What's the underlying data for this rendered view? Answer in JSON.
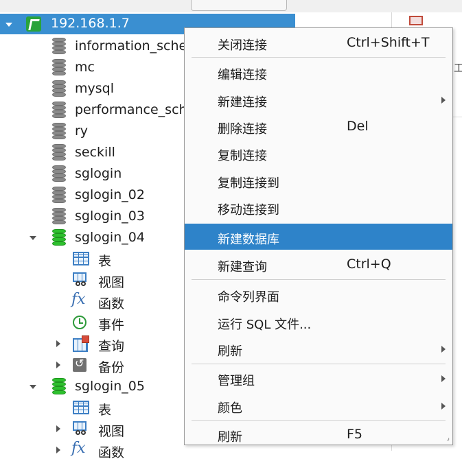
{
  "tree": {
    "connection": "192.168.1.7",
    "databases_a": [
      "information_schema",
      "mc",
      "mysql",
      "performance_schema",
      "ry",
      "seckill",
      "sglogin",
      "sglogin_02",
      "sglogin_03"
    ],
    "db_04": "sglogin_04",
    "db_04_children": [
      "表",
      "视图",
      "函数",
      "事件",
      "查询",
      "备份"
    ],
    "db_05": "sglogin_05",
    "db_05_children": [
      "表",
      "视图",
      "函数"
    ],
    "fx_symbol": "fx"
  },
  "context_menu": {
    "items": [
      {
        "label": "关闭连接",
        "shortcut": "Ctrl+Shift+T"
      },
      {
        "label": "编辑连接",
        "shortcut": ""
      },
      {
        "label": "新建连接",
        "shortcut": "",
        "submenu": true
      },
      {
        "label": "删除连接",
        "shortcut": "Del"
      },
      {
        "label": "复制连接",
        "shortcut": ""
      },
      {
        "label": "复制连接到",
        "shortcut": ""
      },
      {
        "label": "移动连接到",
        "shortcut": ""
      },
      {
        "label": "新建数据库",
        "shortcut": "",
        "highlighted": true
      },
      {
        "label": "新建查询",
        "shortcut": "Ctrl+Q"
      },
      {
        "label": "命令列界面",
        "shortcut": ""
      },
      {
        "label": "运行 SQL 文件...",
        "shortcut": ""
      },
      {
        "label": "刷新",
        "shortcut": "",
        "submenu": true
      },
      {
        "label": "管理组",
        "shortcut": "",
        "submenu": true
      },
      {
        "label": "颜色",
        "shortcut": "",
        "submenu": true
      },
      {
        "label": "刷新",
        "shortcut": "F5"
      }
    ]
  },
  "right_panel": {
    "partial_letter": "工"
  },
  "colors": {
    "selection": "#3a8fd1",
    "menu_highlight": "#2e83c9",
    "db_open": "#2ec02e",
    "db_closed": "#8a8a8a"
  }
}
